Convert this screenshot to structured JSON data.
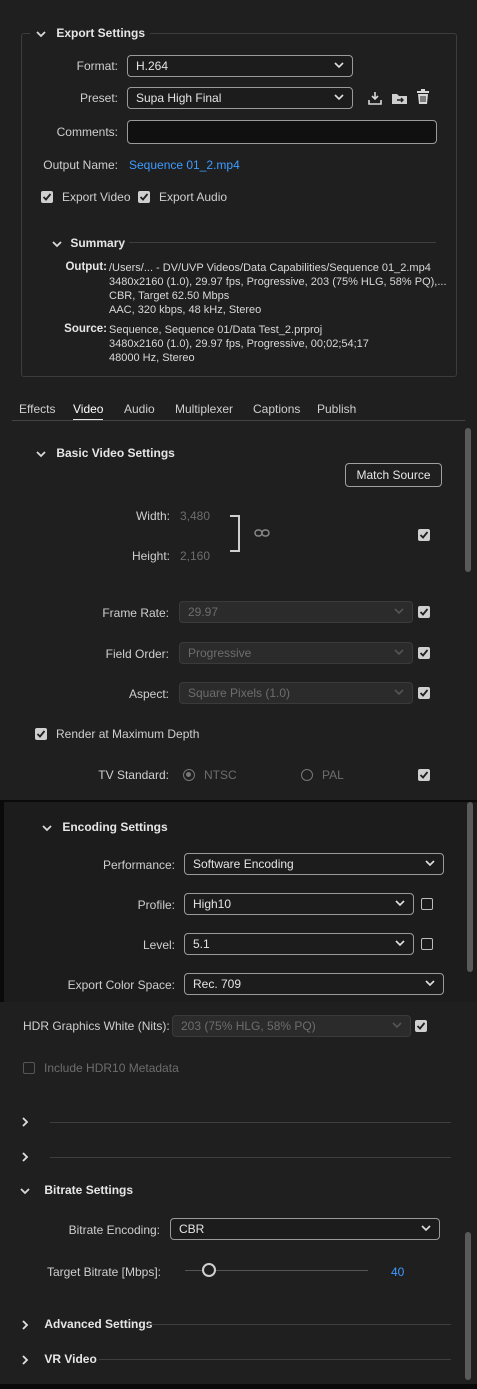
{
  "export_settings": {
    "title": "Export Settings",
    "format_label": "Format:",
    "format_value": "H.264",
    "preset_label": "Preset:",
    "preset_value": "Supa High Final",
    "comments_label": "Comments:",
    "comments_value": "",
    "output_name_label": "Output Name:",
    "output_name_value": "Sequence 01_2.mp4",
    "export_video_label": "Export Video",
    "export_video_checked": true,
    "export_audio_label": "Export Audio",
    "export_audio_checked": true
  },
  "summary": {
    "title": "Summary",
    "output_label": "Output:",
    "output_lines": [
      "/Users/... - DV/UVP Videos/Data Capabilities/Sequence 01_2.mp4",
      "3480x2160 (1.0), 29.97 fps, Progressive, 203 (75% HLG, 58% PQ),...",
      "CBR, Target 62.50 Mbps",
      "AAC, 320 kbps, 48 kHz, Stereo"
    ],
    "source_label": "Source:",
    "source_lines": [
      "Sequence, Sequence 01/Data Test_2.prproj",
      "3480x2160 (1.0), 29.97 fps, Progressive, 00;02;54;17",
      "48000 Hz, Stereo"
    ]
  },
  "tabs": [
    "Effects",
    "Video",
    "Audio",
    "Multiplexer",
    "Captions",
    "Publish"
  ],
  "active_tab": "Video",
  "basic_video": {
    "title": "Basic Video Settings",
    "match_source_label": "Match Source",
    "width_label": "Width:",
    "width_value": "3,480",
    "height_label": "Height:",
    "height_value": "2,160",
    "frame_rate_label": "Frame Rate:",
    "frame_rate_value": "29.97",
    "field_order_label": "Field Order:",
    "field_order_value": "Progressive",
    "aspect_label": "Aspect:",
    "aspect_value": "Square Pixels (1.0)",
    "render_max_depth_label": "Render at Maximum Depth",
    "tv_standard_label": "TV Standard:",
    "tv_ntsc_label": "NTSC",
    "tv_pal_label": "PAL"
  },
  "encoding": {
    "title": "Encoding Settings",
    "performance_label": "Performance:",
    "performance_value": "Software Encoding",
    "profile_label": "Profile:",
    "profile_value": "High10",
    "level_label": "Level:",
    "level_value": "5.1",
    "color_space_label": "Export Color Space:",
    "color_space_value": "Rec. 709",
    "hdr_white_label": "HDR Graphics White (Nits):",
    "hdr_white_value": "203 (75% HLG, 58% PQ)",
    "hdr10_label": "Include HDR10 Metadata"
  },
  "bitrate": {
    "title": "Bitrate Settings",
    "encoding_label": "Bitrate Encoding:",
    "encoding_value": "CBR",
    "target_label": "Target Bitrate [Mbps]:",
    "target_value": "40"
  },
  "advanced_title": "Advanced Settings",
  "vr_title": "VR Video",
  "colors": {
    "background": "#1f1f1f",
    "link": "#3d9bff",
    "text": "#cfcfcf"
  }
}
